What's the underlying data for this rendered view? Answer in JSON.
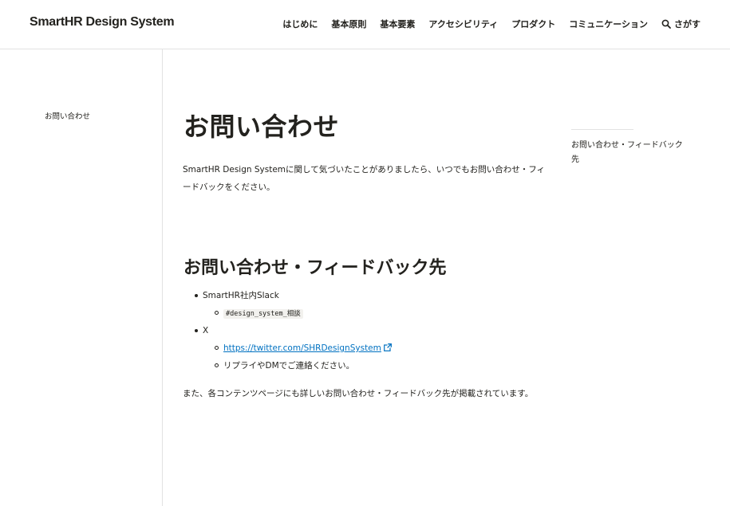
{
  "header": {
    "logo": "SmartHR Design System",
    "nav": [
      "はじめに",
      "基本原則",
      "基本要素",
      "アクセシビリティ",
      "プロダクト",
      "コミュニケーション"
    ],
    "search_label": "さがす"
  },
  "sidebar": {
    "items": [
      "お問い合わせ"
    ]
  },
  "main": {
    "title": "お問い合わせ",
    "intro": "SmartHR Design Systemに関して気づいたことがありましたら、いつでもお問い合わせ・フィードバックをください。",
    "section_title": "お問い合わせ・フィードバック先",
    "list": {
      "slack_label": "SmartHR社内Slack",
      "slack_channel": "#design_system_",
      "slack_channel_suffix": "相談",
      "x_label": "X",
      "x_link": "https://twitter.com/SHRDesignSystem",
      "x_note": "リプライやDMでご連絡ください。"
    },
    "outro": "また、各コンテンツページにも詳しいお問い合わせ・フィードバック先が掲載されています。"
  },
  "toc": {
    "items": [
      "お問い合わせ・フィードバック先"
    ]
  },
  "colors": {
    "text": "#23221e",
    "link": "#0071c1",
    "border": "#e2e2e2"
  }
}
